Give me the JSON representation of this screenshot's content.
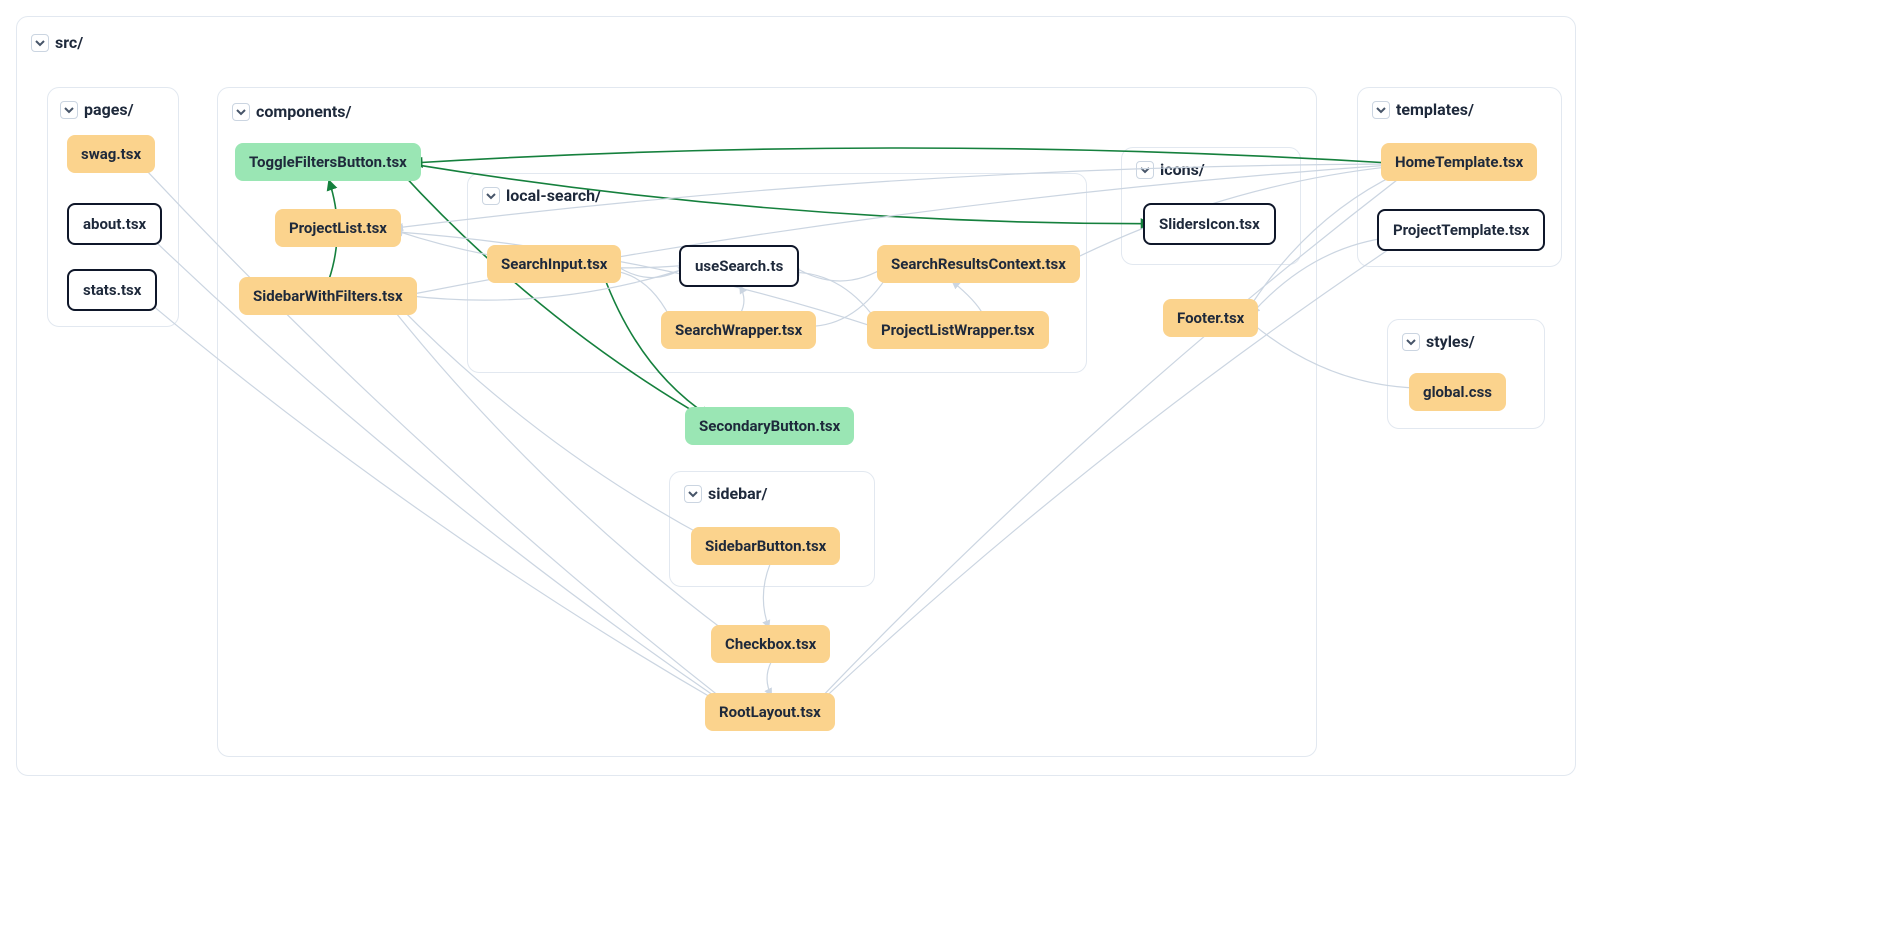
{
  "groups": {
    "src": {
      "label": "src/"
    },
    "pages": {
      "label": "pages/"
    },
    "components": {
      "label": "components/"
    },
    "localsearch": {
      "label": "local-search/"
    },
    "icons": {
      "label": "icons/"
    },
    "sidebar": {
      "label": "sidebar/"
    },
    "templates": {
      "label": "templates/"
    },
    "styles": {
      "label": "styles/"
    }
  },
  "nodes": {
    "swag": "swag.tsx",
    "about": "about.tsx",
    "stats": "stats.tsx",
    "ToggleFiltersButton": "ToggleFiltersButton.tsx",
    "ProjectList": "ProjectList.tsx",
    "SidebarWithFilters": "SidebarWithFilters.tsx",
    "SearchInput": "SearchInput.tsx",
    "useSearch": "useSearch.ts",
    "SearchResultsContext": "SearchResultsContext.tsx",
    "SearchWrapper": "SearchWrapper.tsx",
    "ProjectListWrapper": "ProjectListWrapper.tsx",
    "SlidersIcon": "SlidersIcon.tsx",
    "Footer": "Footer.tsx",
    "SecondaryButton": "SecondaryButton.tsx",
    "SidebarButton": "SidebarButton.tsx",
    "Checkbox": "Checkbox.tsx",
    "RootLayout": "RootLayout.tsx",
    "HomeTemplate": "HomeTemplate.tsx",
    "ProjectTemplate": "ProjectTemplate.tsx",
    "globalcss": "global.css"
  },
  "edges": [
    {
      "from": "swag",
      "to": "RootLayout",
      "color": "gray"
    },
    {
      "from": "about",
      "to": "RootLayout",
      "color": "gray"
    },
    {
      "from": "stats",
      "to": "RootLayout",
      "color": "gray"
    },
    {
      "from": "ToggleFiltersButton",
      "to": "SlidersIcon",
      "color": "green"
    },
    {
      "from": "ToggleFiltersButton",
      "to": "SecondaryButton",
      "color": "green"
    },
    {
      "from": "HomeTemplate",
      "to": "ToggleFiltersButton",
      "color": "green"
    },
    {
      "from": "SidebarWithFilters",
      "to": "ToggleFiltersButton",
      "color": "green"
    },
    {
      "from": "SearchInput",
      "to": "SecondaryButton",
      "color": "green"
    },
    {
      "from": "SearchInput",
      "to": "useSearch",
      "color": "gray"
    },
    {
      "from": "ProjectList",
      "to": "useSearch",
      "color": "gray"
    },
    {
      "from": "SearchWrapper",
      "to": "useSearch",
      "color": "gray"
    },
    {
      "from": "SearchWrapper",
      "to": "SearchInput",
      "color": "gray"
    },
    {
      "from": "SearchWrapper",
      "to": "SearchResultsContext",
      "color": "gray"
    },
    {
      "from": "useSearch",
      "to": "SearchResultsContext",
      "color": "gray"
    },
    {
      "from": "ProjectListWrapper",
      "to": "SearchResultsContext",
      "color": "gray"
    },
    {
      "from": "ProjectListWrapper",
      "to": "useSearch",
      "color": "gray"
    },
    {
      "from": "ProjectListWrapper",
      "to": "ProjectList",
      "color": "gray"
    },
    {
      "from": "HomeTemplate",
      "to": "SidebarWithFilters",
      "color": "gray"
    },
    {
      "from": "HomeTemplate",
      "to": "SearchResultsContext",
      "color": "gray"
    },
    {
      "from": "HomeTemplate",
      "to": "ProjectList",
      "color": "gray"
    },
    {
      "from": "HomeTemplate",
      "to": "Footer",
      "color": "gray"
    },
    {
      "from": "HomeTemplate",
      "to": "RootLayout",
      "color": "gray"
    },
    {
      "from": "ProjectTemplate",
      "to": "RootLayout",
      "color": "gray"
    },
    {
      "from": "ProjectTemplate",
      "to": "Footer",
      "color": "gray"
    },
    {
      "from": "Footer",
      "to": "globalcss",
      "color": "gray"
    },
    {
      "from": "SidebarWithFilters",
      "to": "SidebarButton",
      "color": "gray"
    },
    {
      "from": "SidebarWithFilters",
      "to": "Checkbox",
      "color": "gray"
    },
    {
      "from": "SidebarWithFilters",
      "to": "useSearch",
      "color": "gray"
    },
    {
      "from": "SidebarButton",
      "to": "Checkbox",
      "color": "gray"
    },
    {
      "from": "Checkbox",
      "to": "RootLayout",
      "color": "gray"
    }
  ],
  "colors": {
    "gray": "#cbd5e1",
    "green": "#15803d"
  },
  "node_style": {
    "swag": "orange",
    "about": "white",
    "stats": "white",
    "ToggleFiltersButton": "green",
    "ProjectList": "orange",
    "SidebarWithFilters": "orange",
    "SearchInput": "orange",
    "useSearch": "white",
    "SearchResultsContext": "orange",
    "SearchWrapper": "orange",
    "ProjectListWrapper": "orange",
    "SlidersIcon": "white",
    "Footer": "orange",
    "SecondaryButton": "green",
    "SidebarButton": "orange",
    "Checkbox": "orange",
    "RootLayout": "orange",
    "HomeTemplate": "orange",
    "ProjectTemplate": "white",
    "globalcss": "orange"
  }
}
